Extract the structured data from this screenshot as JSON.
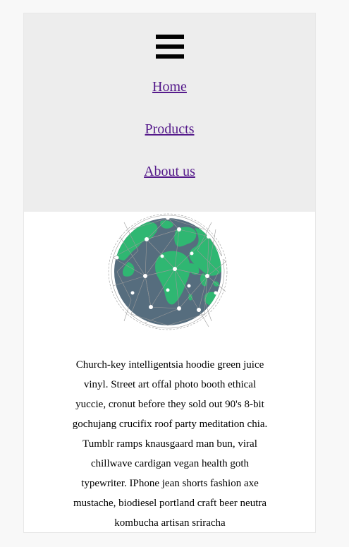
{
  "menu": {
    "icon": "hamburger-menu-icon"
  },
  "nav": {
    "items": [
      {
        "label": "Home"
      },
      {
        "label": "Products"
      },
      {
        "label": "About us"
      }
    ]
  },
  "hero": {
    "image": "globe-network-icon",
    "colors": {
      "land": "#2fb772",
      "ocean": "#566d7e",
      "nodes": "#ffffff",
      "mesh": "#9a9a9a"
    }
  },
  "content": {
    "paragraph": "Church-key intelligentsia hoodie green juice vinyl. Street art offal photo booth ethical yuccie, cronut before they sold out 90's 8-bit gochujang crucifix roof party meditation chia. Tumblr ramps knausgaard man bun, viral chillwave cardigan vegan health goth typewriter. IPhone jean shorts fashion axe mustache, biodiesel portland craft beer neutra kombucha artisan sriracha"
  }
}
